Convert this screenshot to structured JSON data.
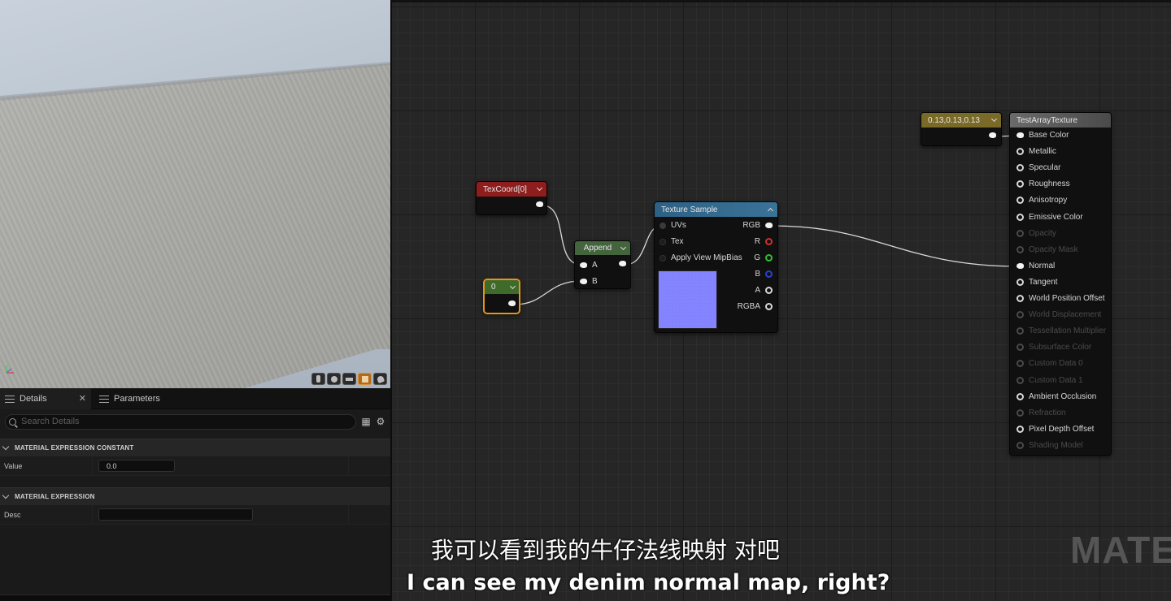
{
  "viewport": {
    "buttons": [
      "cylinder-icon",
      "sphere-icon",
      "plane-icon",
      "cube-icon",
      "teapot-icon"
    ],
    "active_button": "cube-icon"
  },
  "details": {
    "tab_details": "Details",
    "tab_parameters": "Parameters",
    "search_placeholder": "Search Details",
    "section1": "MATERIAL EXPRESSION CONSTANT",
    "value_label": "Value",
    "value": "0.0",
    "section2": "MATERIAL EXPRESSION",
    "desc_label": "Desc",
    "desc_value": ""
  },
  "graph": {
    "texcoord": {
      "title": "TexCoord[0]",
      "color": "#8e1d1d"
    },
    "constant": {
      "title": "0",
      "color": "#3f6b2a",
      "selected_color": "#e6941c"
    },
    "append": {
      "title": "Append",
      "color": "#43643d",
      "pin_a": "A",
      "pin_b": "B"
    },
    "texture_sample": {
      "title": "Texture Sample",
      "color": "#2d6184",
      "inputs": [
        "UVs",
        "Tex",
        "Apply View MipBias"
      ],
      "outputs": [
        "RGB",
        "R",
        "G",
        "B",
        "A",
        "RGBA"
      ],
      "preview_color": "#8080ff"
    },
    "color_constant": {
      "title": "0.13,0.13,0.13",
      "color": "#7a6a28"
    },
    "material": {
      "title": "TestArrayTexture",
      "inputs": [
        {
          "label": "Base Color",
          "state": "connected"
        },
        {
          "label": "Metallic",
          "state": "active"
        },
        {
          "label": "Specular",
          "state": "active"
        },
        {
          "label": "Roughness",
          "state": "active"
        },
        {
          "label": "Anisotropy",
          "state": "active"
        },
        {
          "label": "Emissive Color",
          "state": "active"
        },
        {
          "label": "Opacity",
          "state": "disabled"
        },
        {
          "label": "Opacity Mask",
          "state": "disabled"
        },
        {
          "label": "Normal",
          "state": "connected"
        },
        {
          "label": "Tangent",
          "state": "active"
        },
        {
          "label": "World Position Offset",
          "state": "active"
        },
        {
          "label": "World Displacement",
          "state": "disabled"
        },
        {
          "label": "Tessellation Multiplier",
          "state": "disabled"
        },
        {
          "label": "Subsurface Color",
          "state": "disabled"
        },
        {
          "label": "Custom Data 0",
          "state": "disabled"
        },
        {
          "label": "Custom Data 1",
          "state": "disabled"
        },
        {
          "label": "Ambient Occlusion",
          "state": "active"
        },
        {
          "label": "Refraction",
          "state": "disabled"
        },
        {
          "label": "Pixel Depth Offset",
          "state": "active"
        },
        {
          "label": "Shading Model",
          "state": "disabled"
        }
      ]
    }
  },
  "subtitles": {
    "chinese": "我可以看到我的牛仔法线映射 对吧",
    "english": "I can see my denim normal map, right?"
  },
  "watermark": "MATEF"
}
